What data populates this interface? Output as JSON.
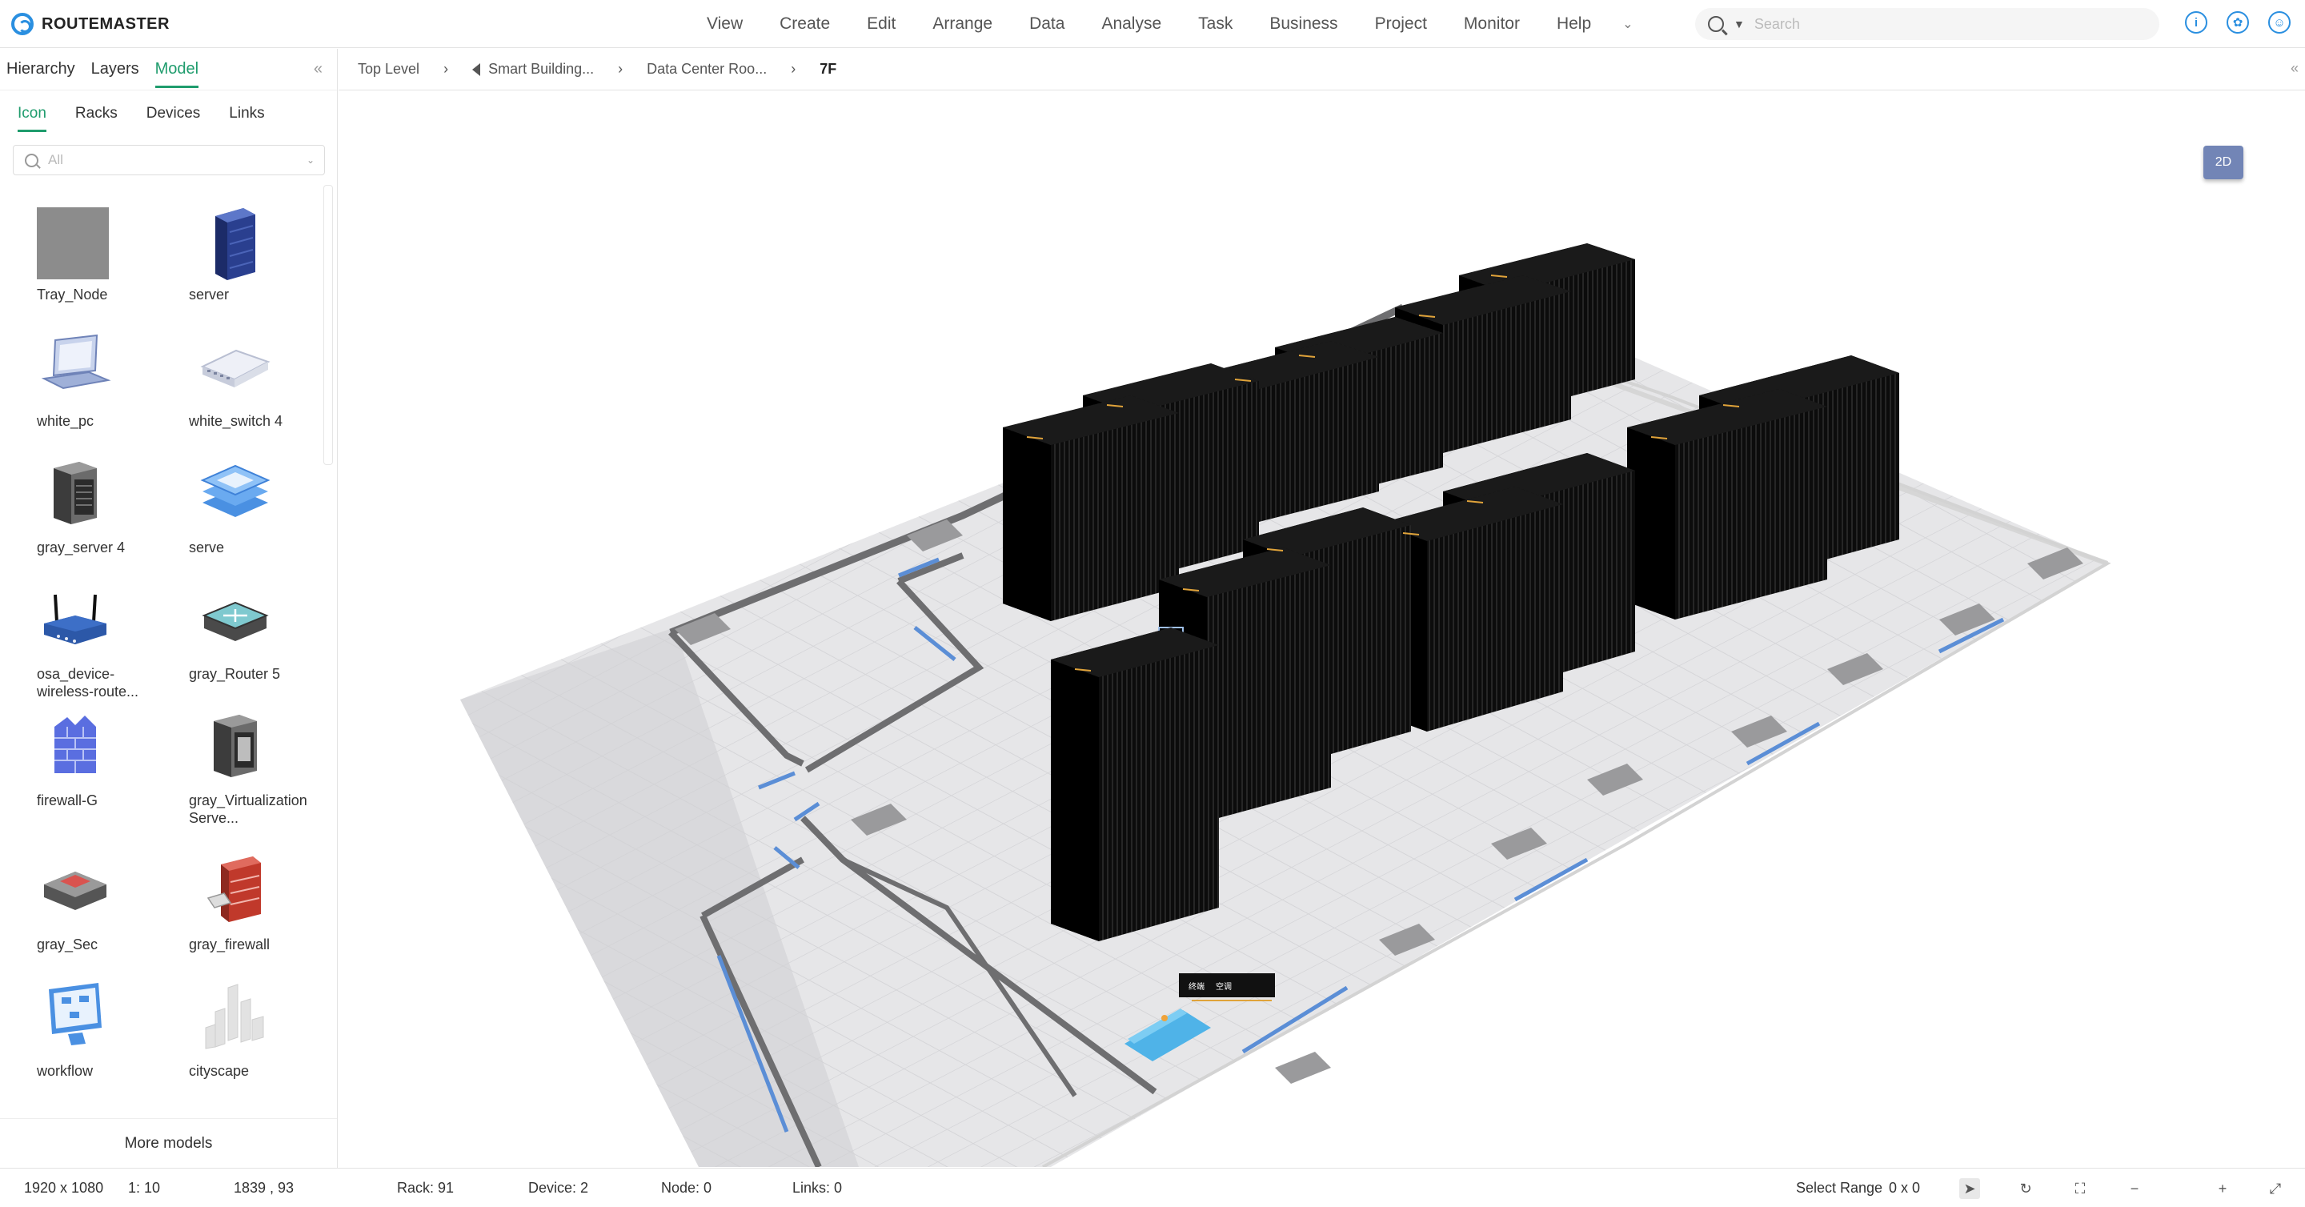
{
  "app": {
    "name": "ROUTEMASTER"
  },
  "menu": [
    "View",
    "Create",
    "Edit",
    "Arrange",
    "Data",
    "Analyse",
    "Task",
    "Business",
    "Project",
    "Monitor",
    "Help"
  ],
  "search": {
    "placeholder": "Search"
  },
  "top_icons": [
    "info-icon",
    "network-icon",
    "user-icon"
  ],
  "left_panel": {
    "tabs": [
      "Hierarchy",
      "Layers",
      "Model"
    ],
    "active_tab": "Model",
    "sub_tabs": [
      "Icon",
      "Racks",
      "Devices",
      "Links"
    ],
    "active_sub_tab": "Icon",
    "filter": {
      "value": "All"
    },
    "items": [
      {
        "label": "Tray_Node",
        "icon": "tray-node-icon"
      },
      {
        "label": "server",
        "icon": "server-icon"
      },
      {
        "label": "white_pc",
        "icon": "laptop-icon"
      },
      {
        "label": "white_switch 4",
        "icon": "switch-icon"
      },
      {
        "label": "gray_server 4",
        "icon": "gray-server-icon"
      },
      {
        "label": "serve",
        "icon": "stack-icon"
      },
      {
        "label": "osa_device-wireless-route...",
        "icon": "wireless-router-icon"
      },
      {
        "label": "gray_Router 5",
        "icon": "router-icon"
      },
      {
        "label": "firewall-G",
        "icon": "firewall-blue-icon"
      },
      {
        "label": "gray_Virtualization Serve...",
        "icon": "virtualization-server-icon"
      },
      {
        "label": "gray_Sec",
        "icon": "security-device-icon"
      },
      {
        "label": "gray_firewall",
        "icon": "firewall-red-icon"
      },
      {
        "label": "workflow",
        "icon": "workflow-icon"
      },
      {
        "label": "cityscape",
        "icon": "cityscape-icon"
      }
    ],
    "more_label": "More models"
  },
  "breadcrumb": [
    "Top Level",
    "Smart Building...",
    "Data Center Roo...",
    "7F"
  ],
  "view_toggle": "2D",
  "status": {
    "resolution": "1920 x 1080",
    "scale": "1: 10",
    "cursor": "1839 , 93",
    "rack": "Rack: 91",
    "device": "Device: 2",
    "node": "Node: 0",
    "links": "Links: 0",
    "select_range": "Select Range",
    "select_size": "0 x 0"
  },
  "colors": {
    "accent": "#1f9c6d",
    "brand": "#2a8fe0",
    "rack": "#111111",
    "floor": "#e4e4e6",
    "wall": "#6e6e70",
    "window": "#5b8ed6"
  }
}
